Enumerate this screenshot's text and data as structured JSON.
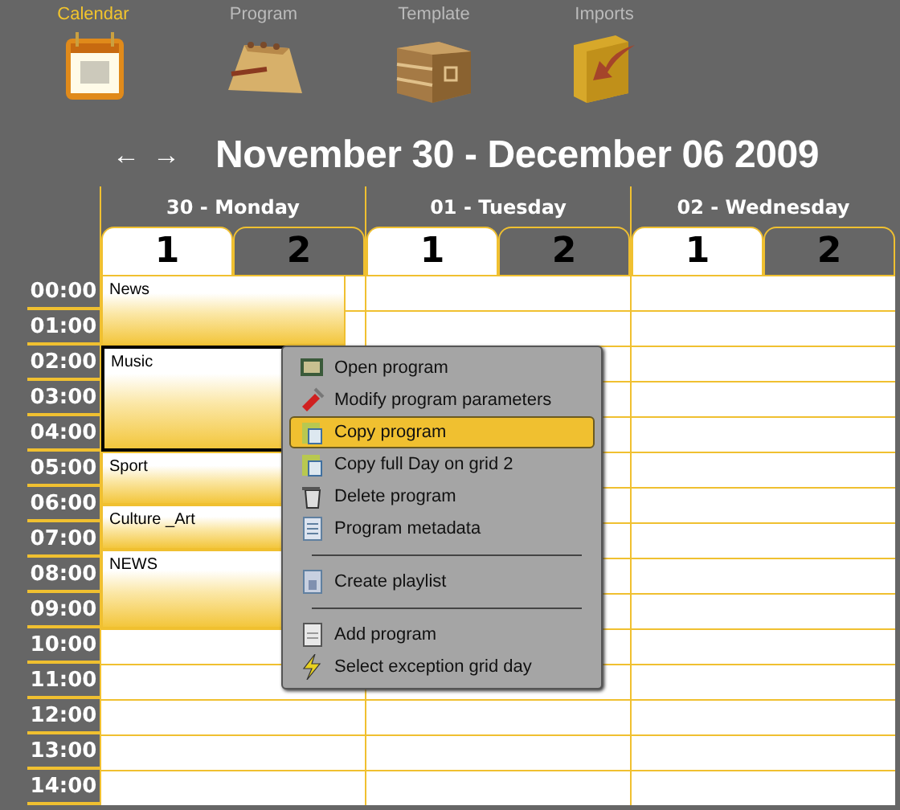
{
  "toolbar": [
    {
      "label": "Calendar",
      "selected": true
    },
    {
      "label": "Program",
      "selected": false
    },
    {
      "label": "Template",
      "selected": false
    },
    {
      "label": "Imports",
      "selected": false
    }
  ],
  "navigation": {
    "previous": "←",
    "next": "→"
  },
  "title": "November 30 - December 06 2009",
  "times": [
    "00:00",
    "01:00",
    "02:00",
    "03:00",
    "04:00",
    "05:00",
    "06:00",
    "07:00",
    "08:00",
    "09:00",
    "10:00",
    "11:00",
    "12:00",
    "13:00",
    "14:00"
  ],
  "days": [
    {
      "label": "30 - Monday",
      "grids": [
        {
          "label": "1",
          "selected": true
        },
        {
          "label": "2",
          "selected": false
        }
      ],
      "events": [
        {
          "title": "News",
          "selected": false
        },
        {
          "title": "Music",
          "selected": true
        },
        {
          "title": "Sport",
          "selected": false
        },
        {
          "title": "Culture _Art",
          "selected": false
        },
        {
          "title": "NEWS",
          "selected": false
        }
      ]
    },
    {
      "label": "01 - Tuesday",
      "grids": [
        {
          "label": "1",
          "selected": true
        },
        {
          "label": "2",
          "selected": false
        }
      ]
    },
    {
      "label": "02 - Wednesday",
      "grids": [
        {
          "label": "1",
          "selected": true
        },
        {
          "label": "2",
          "selected": false
        }
      ]
    }
  ],
  "context_menu": {
    "items": [
      {
        "kind": "item",
        "label": "Open program",
        "selected": false
      },
      {
        "kind": "item",
        "label": "Modify program parameters",
        "selected": false
      },
      {
        "kind": "item",
        "label": "Copy program",
        "selected": true
      },
      {
        "kind": "item",
        "label": "Copy full Day on grid 2",
        "selected": false
      },
      {
        "kind": "item",
        "label": "Delete program",
        "selected": false
      },
      {
        "kind": "item",
        "label": "Program metadata",
        "selected": false
      },
      {
        "kind": "separator"
      },
      {
        "kind": "item",
        "label": "Create playlist",
        "selected": false
      },
      {
        "kind": "separator"
      },
      {
        "kind": "item",
        "label": "Add program",
        "selected": false
      },
      {
        "kind": "item",
        "label": "Select exception grid day",
        "selected": false
      }
    ]
  }
}
